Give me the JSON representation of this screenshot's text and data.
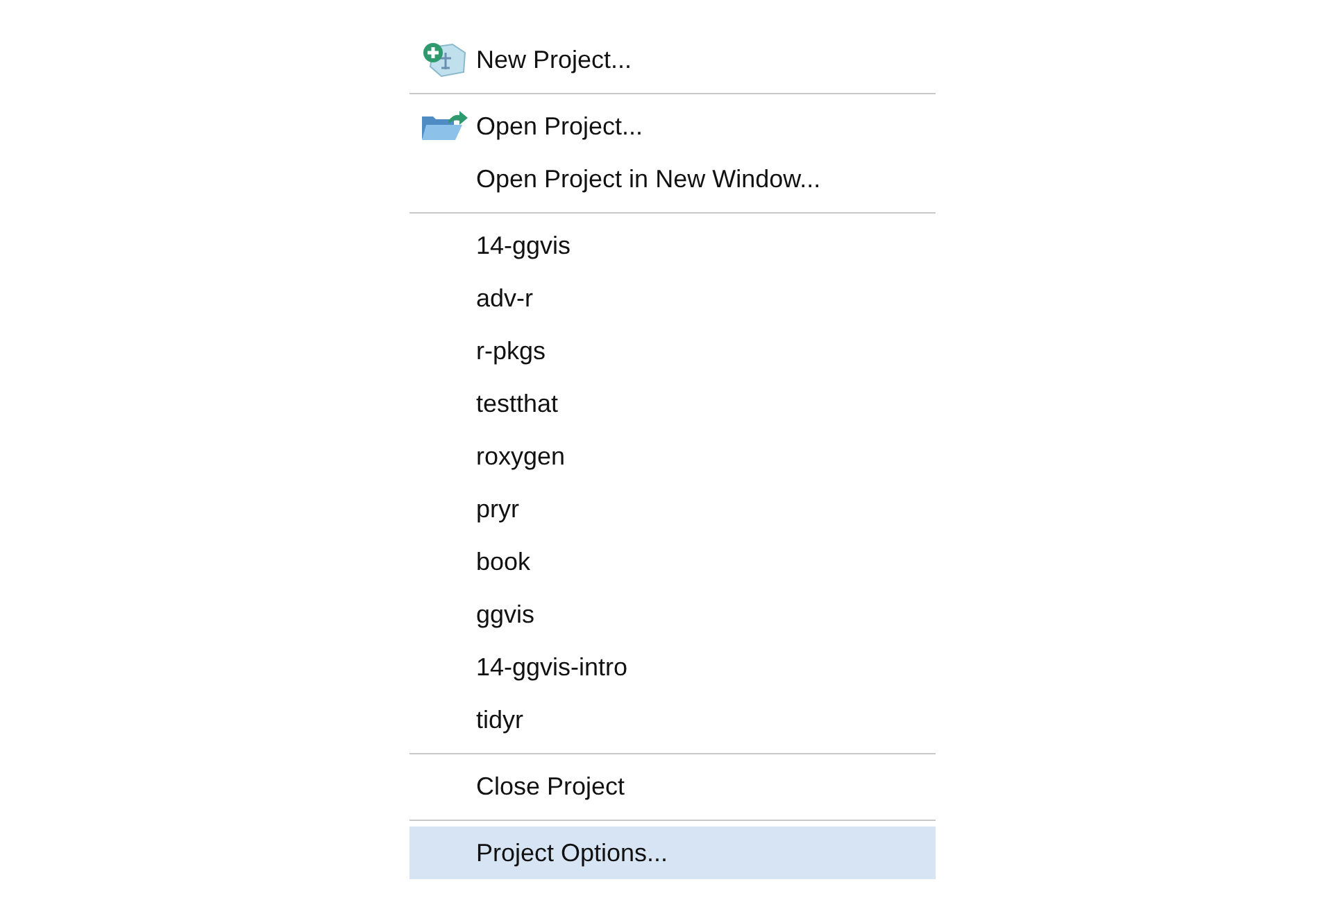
{
  "menu": {
    "items": [
      {
        "kind": "new-item",
        "label": "New Project...",
        "selected": false
      },
      {
        "kind": "separator"
      },
      {
        "kind": "open-item",
        "label": "Open Project...",
        "selected": false
      },
      {
        "kind": "item",
        "label": "Open Project in New Window...",
        "selected": false
      },
      {
        "kind": "separator"
      },
      {
        "kind": "item",
        "label": "14-ggvis",
        "selected": false
      },
      {
        "kind": "item",
        "label": "adv-r",
        "selected": false
      },
      {
        "kind": "item",
        "label": "r-pkgs",
        "selected": false
      },
      {
        "kind": "item",
        "label": "testthat",
        "selected": false
      },
      {
        "kind": "item",
        "label": "roxygen",
        "selected": false
      },
      {
        "kind": "item",
        "label": "pryr",
        "selected": false
      },
      {
        "kind": "item",
        "label": "book",
        "selected": false
      },
      {
        "kind": "item",
        "label": "ggvis",
        "selected": false
      },
      {
        "kind": "item",
        "label": "14-ggvis-intro",
        "selected": false
      },
      {
        "kind": "item",
        "label": "tidyr",
        "selected": false
      },
      {
        "kind": "separator"
      },
      {
        "kind": "item",
        "label": "Close Project",
        "selected": false
      },
      {
        "kind": "separator"
      },
      {
        "kind": "item",
        "label": "Project Options...",
        "selected": true
      }
    ]
  }
}
